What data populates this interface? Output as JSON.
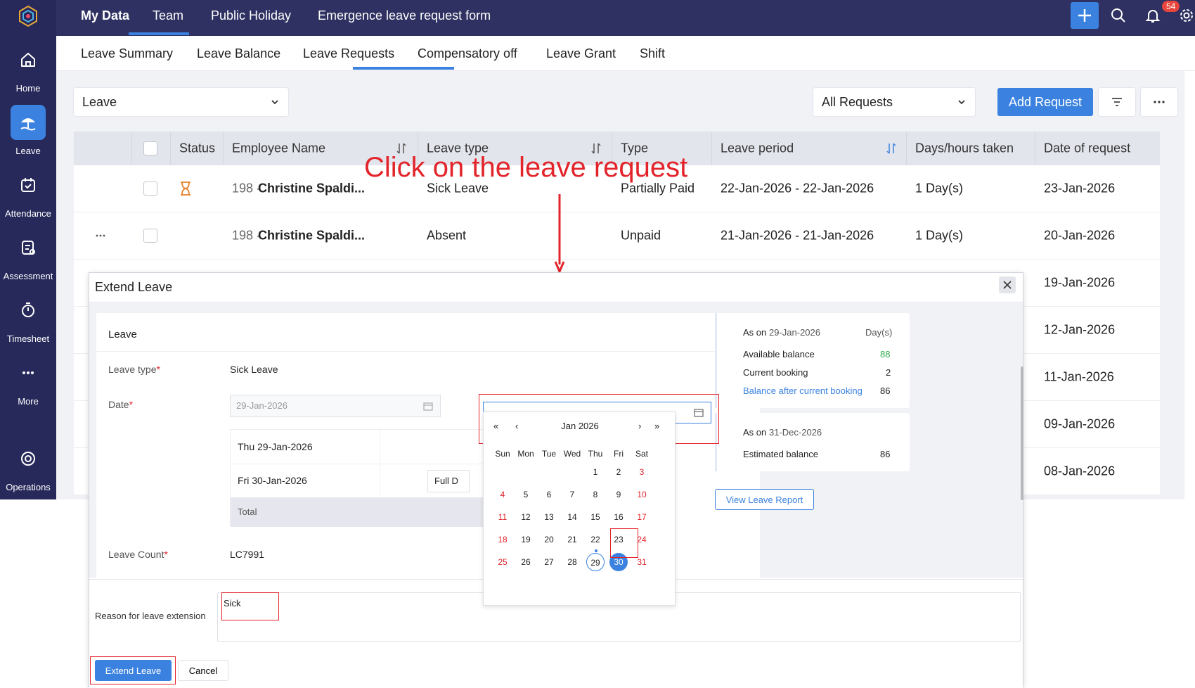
{
  "sidebar": {
    "items": [
      {
        "label": "Home",
        "icon": "home-icon"
      },
      {
        "label": "Leave",
        "icon": "leave-icon"
      },
      {
        "label": "Attendance",
        "icon": "attendance-icon"
      },
      {
        "label": "Assessment",
        "icon": "assessment-icon"
      },
      {
        "label": "Timesheet",
        "icon": "timesheet-icon"
      },
      {
        "label": "More",
        "icon": "more-icon"
      },
      {
        "label": "Operations",
        "icon": "operations-icon"
      }
    ]
  },
  "topbar": {
    "tabs": [
      "My Data",
      "Team",
      "Public Holiday",
      "Emergence leave request form"
    ],
    "notification_count": "54"
  },
  "subnav": {
    "tabs": [
      "Leave Summary",
      "Leave Balance",
      "Leave Requests",
      "Compensatory off",
      "Leave Grant",
      "Shift"
    ]
  },
  "toolbar": {
    "leave_select": "Leave",
    "requests_select": "All Requests",
    "add_request": "Add Request"
  },
  "table": {
    "headers": {
      "status": "Status",
      "employee": "Employee Name",
      "leave_type": "Leave type",
      "type": "Type",
      "period": "Leave period",
      "days": "Days/hours taken",
      "date": "Date of request"
    },
    "rows": [
      {
        "emp_id": "198 -",
        "emp_name": "Christine Spaldi...",
        "leave_type": "Sick Leave",
        "type": "Partially Paid",
        "period": "22-Jan-2026 - 22-Jan-2026",
        "days": "1 Day(s)",
        "date": "23-Jan-2026"
      },
      {
        "emp_id": "198 -",
        "emp_name": "Christine Spaldi...",
        "leave_type": "Absent",
        "type": "Unpaid",
        "period": "21-Jan-2026 - 21-Jan-2026",
        "days": "1 Day(s)",
        "date": "20-Jan-2026"
      }
    ],
    "extra_dates": [
      "19-Jan-2026",
      "12-Jan-2026",
      "11-Jan-2026",
      "09-Jan-2026",
      "08-Jan-2026"
    ]
  },
  "annotation": "Click on the leave request",
  "modal": {
    "title": "Extend Leave",
    "section": "Leave",
    "leave_type_label": "Leave type",
    "leave_type_value": "Sick Leave",
    "date_label": "Date",
    "date_from": "29-Jan-2026",
    "day1": "Thu 29-Jan-2026",
    "day2": "Fri 30-Jan-2026",
    "day2_select": "Full D",
    "total_label": "Total",
    "leave_count_label": "Leave Count",
    "leave_count_value": "LC7991",
    "reason_label": "Reason for leave extension",
    "reason_value": "Sick",
    "extend_button": "Extend Leave",
    "cancel_button": "Cancel"
  },
  "calendar": {
    "month": "Jan 2026",
    "dows": [
      "Sun",
      "Mon",
      "Tue",
      "Wed",
      "Thu",
      "Fri",
      "Sat"
    ],
    "weeks": [
      [
        "",
        "",
        "",
        "",
        "1",
        "2",
        "3"
      ],
      [
        "4",
        "5",
        "6",
        "7",
        "8",
        "9",
        "10"
      ],
      [
        "11",
        "12",
        "13",
        "14",
        "15",
        "16",
        "17"
      ],
      [
        "18",
        "19",
        "20",
        "21",
        "22",
        "23",
        "24"
      ],
      [
        "25",
        "26",
        "27",
        "28",
        "29",
        "30",
        "31"
      ]
    ],
    "today": "29",
    "selected": "30"
  },
  "balance": {
    "as_on_label": "As on",
    "as_on_date": "29-Jan-2026",
    "unit": "Day(s)",
    "available_label": "Available balance",
    "available": "88",
    "current_label": "Current booking",
    "current": "2",
    "after_label": "Balance after current booking",
    "after": "86",
    "est_as_on_label": "As on",
    "est_date": "31-Dec-2026",
    "est_label": "Estimated balance",
    "est": "86",
    "report_button": "View Leave Report"
  },
  "colors": {
    "accent": "#3b82e0",
    "sidebar": "#27295a",
    "topbar": "#2e3161",
    "annotation": "#e3242b",
    "positive": "#2eaa4a"
  }
}
